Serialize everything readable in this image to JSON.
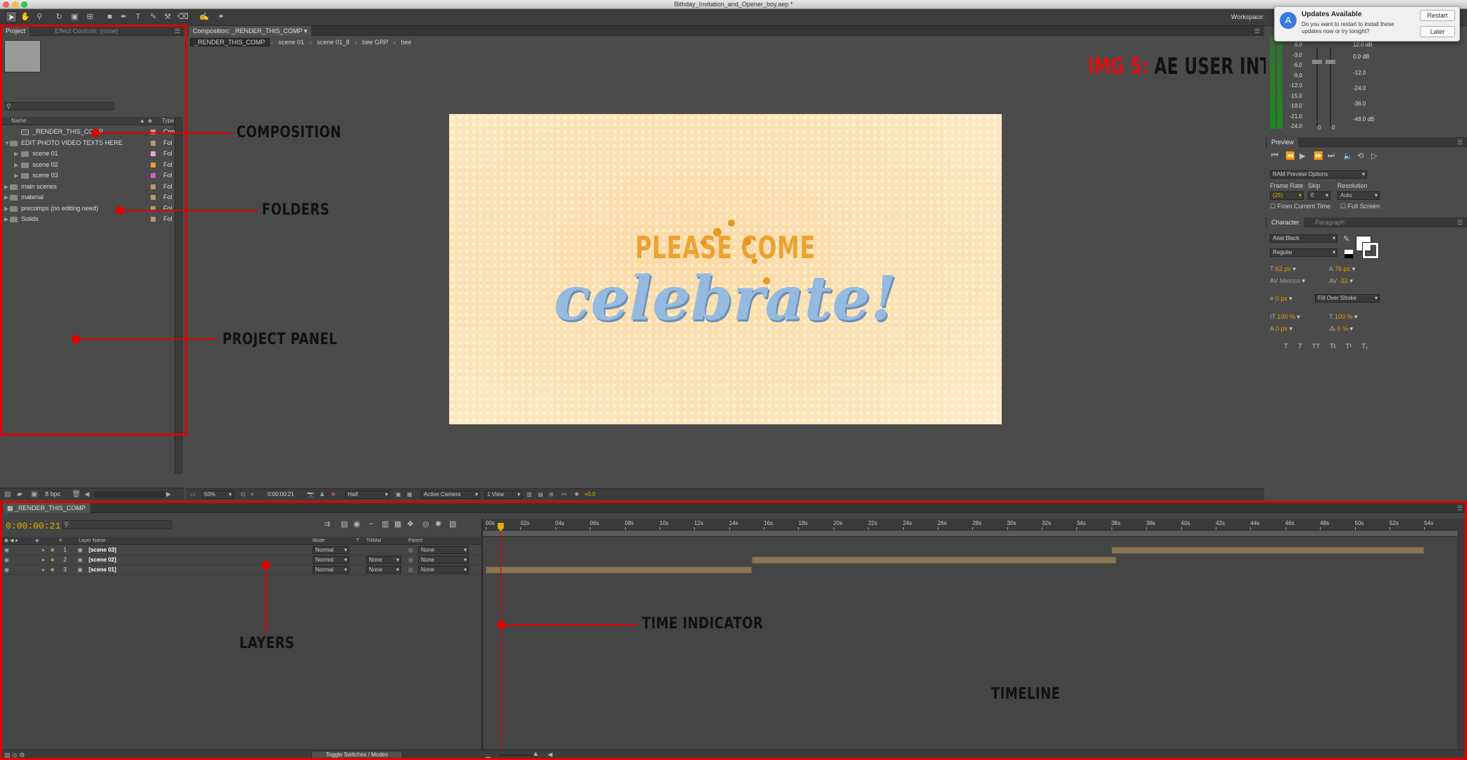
{
  "window": {
    "title": "Bithday_Invitation_and_Opener_boy.aep *",
    "workspace_label": "Workspace:"
  },
  "project": {
    "tab": "Project",
    "effect_tab": "Effect Controls: (none)",
    "col_name": "Name",
    "col_type": "Type",
    "items": [
      {
        "name": "_RENDER_THIS_COMP",
        "type": "Con",
        "color": "#e08a8a",
        "indent": 1,
        "comp": true
      },
      {
        "name": "EDIT PHOTO VIDEO TEXTS HERE",
        "type": "Fol",
        "color": "#b69a6c",
        "indent": 0,
        "open": true
      },
      {
        "name": "scene 01",
        "type": "Fol",
        "color": "#e6a6c8",
        "indent": 1
      },
      {
        "name": "scene 02",
        "type": "Fol",
        "color": "#e8a030",
        "indent": 1
      },
      {
        "name": "scene 03",
        "type": "Fol",
        "color": "#d060c0",
        "indent": 1
      },
      {
        "name": "main scenes",
        "type": "Fol",
        "color": "#b69a6c",
        "indent": 0
      },
      {
        "name": "material",
        "type": "Fol",
        "color": "#b69a6c",
        "indent": 0
      },
      {
        "name": "precomps (no editing need)",
        "type": "Fol",
        "color": "#b69a6c",
        "indent": 0
      },
      {
        "name": "Solids",
        "type": "Fol",
        "color": "#b69a6c",
        "indent": 0
      }
    ],
    "bpc": "8 bpc"
  },
  "composition": {
    "tab": "Composition: _RENDER_THIS_COMP",
    "breadcrumbs": [
      "_RENDER_THIS_COMP",
      "scene 01",
      "scene 01_8",
      "bee GRP",
      "bee"
    ],
    "zoom": "50%",
    "time": "0:00:00:21",
    "resolution": "Half",
    "camera": "Active Camera",
    "view": "1 View",
    "exposure": "+0.0",
    "card_line1": "PLEASE COME",
    "card_line2": "celebrate!"
  },
  "header_title": {
    "prefix": "IMG 5:",
    "rest": "AE USER INTERFACE"
  },
  "notification": {
    "title": "Updates Available",
    "body": "Do you want to restart to install these updates now or try tonight?",
    "restart": "Restart",
    "later": "Later"
  },
  "audio": {
    "left": [
      "0.0",
      "-3.0",
      "-6.0",
      "-9.0",
      "-12.0",
      "-15.0",
      "-18.0",
      "-21.0",
      "-24.0"
    ],
    "right": [
      "12.0 dB",
      "0.0 dB",
      "-12.0",
      "-24.0",
      "-36.0",
      "-48.0 dB"
    ],
    "zero": "0"
  },
  "preview": {
    "tab": "Preview",
    "ram": "RAM Preview Options",
    "frame_rate_label": "Frame Rate",
    "skip_label": "Skip",
    "resolution_label": "Resolution",
    "frame_rate": "(25)",
    "skip": "0",
    "resolution": "Auto",
    "from_current": "From Current Time",
    "full_screen": "Full Screen"
  },
  "character": {
    "tab": "Character",
    "tab2": "Paragraph",
    "font": "Arial Black",
    "style": "Regular",
    "size": "62 px",
    "leading": "76 px",
    "kerning": "Metrics",
    "tracking": "-22",
    "stroke": "0 px",
    "stroke_type": "Fill Over Stroke",
    "vscale": "100 %",
    "hscale": "100 %",
    "baseline": "0 px",
    "tsume": "0 %",
    "styles": [
      "T",
      "T",
      "TT",
      "Tt",
      "T¹",
      "T₁"
    ]
  },
  "timeline": {
    "tab": "_RENDER_THIS_COMP",
    "time": "0:00:00:21",
    "col_layer_name": "Layer Name",
    "col_mode": "Mode",
    "col_t": "T",
    "col_trkmat": "TrkMat",
    "col_parent": "Parent",
    "layers": [
      {
        "num": "1",
        "name": "[scene 03]",
        "mode": "Normal",
        "trkmat": "",
        "parent": "None",
        "start": 36,
        "end": 54
      },
      {
        "num": "2",
        "name": "[scene 02]",
        "mode": "Normal",
        "trkmat": "None",
        "parent": "None",
        "start": 15.3,
        "end": 36.3
      },
      {
        "num": "3",
        "name": "[scene 01]",
        "mode": "Normal",
        "trkmat": "None",
        "parent": "None",
        "start": 0,
        "end": 15.3
      }
    ],
    "ruler": [
      "00s",
      "02s",
      "04s",
      "06s",
      "08s",
      "10s",
      "12s",
      "14s",
      "16s",
      "18s",
      "20s",
      "22s",
      "24s",
      "26s",
      "28s",
      "30s",
      "32s",
      "34s",
      "36s",
      "38s",
      "40s",
      "42s",
      "44s",
      "46s",
      "48s",
      "50s",
      "52s",
      "54s"
    ],
    "playhead_seconds": 0.84,
    "toggle_label": "Toggle Switches / Modes"
  },
  "callouts": {
    "composition": "COMPOSITION",
    "folders": "FOLDERS",
    "project_panel": "PROJECT PANEL",
    "layers": "LAYERS",
    "time_indicator": "TIME INDICATOR",
    "timeline": "TIMELINE"
  }
}
